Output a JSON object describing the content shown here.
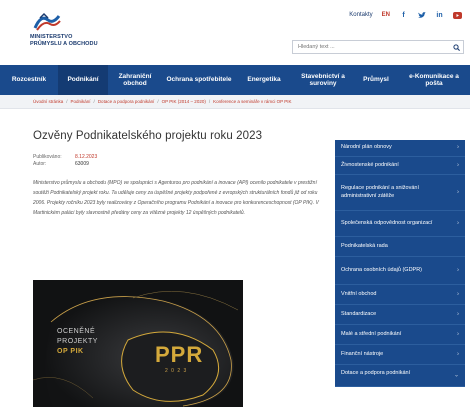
{
  "header": {
    "logo_text": "MINISTERSTVO\nPRŮMYSLU A OBCHODU",
    "top_links": {
      "contacts": "Kontakty",
      "lang": "EN"
    },
    "social": [
      "f",
      "t",
      "in",
      "yt"
    ],
    "search": {
      "placeholder": "Hledaný text ..."
    }
  },
  "nav": {
    "items": [
      {
        "label": "Rozcestník",
        "active": false
      },
      {
        "label": "Podnikání",
        "active": true
      },
      {
        "label": "Zahraniční obchod",
        "active": false
      },
      {
        "label": "Ochrana spotřebitele",
        "active": false
      },
      {
        "label": "Energetika",
        "active": false
      },
      {
        "label": "Stavebnictví a suroviny",
        "active": false
      },
      {
        "label": "Průmysl",
        "active": false
      },
      {
        "label": "e-Komunikace a pošta",
        "active": false
      }
    ]
  },
  "breadcrumb": [
    "Úvodní stránka",
    "Podnikání",
    "Dotace a podpora podnikání",
    "OP PIK (2014 – 2020)",
    "Konference a semináře v rámci OP PIK"
  ],
  "article": {
    "title": "Ozvěny Podnikatelského projektu roku 2023",
    "published_label": "Publikováno:",
    "published_value": "8.12.2023",
    "author_label": "Autor:",
    "author_value": "63009",
    "body": "Ministerstvo průmyslu a obchodu (MPO) ve spolupráci s Agenturou pro podnikání a inovace (API) ocenilo podnikatele v prestižní soutěži Podnikatelský projekt roku. Ta uděluje ceny za úspěšné projekty podpořené z evropských strukturálních fondů již od roku 2006. Projekty ročníku 2023 byly realizovány z Operačního programu Podnikání a inovace pro konkurenceschopnost (OP PIK). V Martinickém paláci byly slavnostně předány ceny za vítězné projekty 12 úspěšných podnikatelů.",
    "hero": {
      "line1": "OCENĚNÉ",
      "line2": "PROJEKTY",
      "line3": "OP PIK",
      "logo": "PPR",
      "year": "2 0 2 3"
    }
  },
  "sidebar": {
    "items": [
      {
        "label": "Národní plán obnovy",
        "chevron": "›"
      },
      {
        "label": "Živnostenské podnikání",
        "chevron": "›"
      },
      {
        "label": "Regulace podnikání a snižování administrativní zátěže",
        "chevron": "›"
      },
      {
        "label": "Společenská odpovědnost organizací",
        "chevron": "›"
      },
      {
        "label": "Podnikatelská rada",
        "chevron": ""
      },
      {
        "label": "Ochrana osobních údajů (GDPR)",
        "chevron": "›"
      },
      {
        "label": "Vnitřní obchod",
        "chevron": "›"
      },
      {
        "label": "Standardizace",
        "chevron": "›"
      },
      {
        "label": "Malé a střední podnikání",
        "chevron": "›"
      },
      {
        "label": "Finanční nástroje",
        "chevron": "›"
      },
      {
        "label": "Dotace a podpora podnikání",
        "chevron": "⌄"
      }
    ]
  },
  "colors": {
    "brand": "#1a4a8c",
    "accent": "#c0392b",
    "gold": "#d4a93b"
  }
}
